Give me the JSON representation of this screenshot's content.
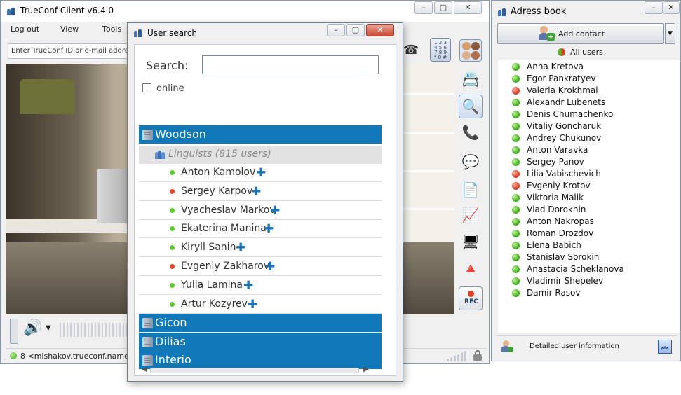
{
  "main_window": {
    "title": "TrueConf Client v6.4.0",
    "menu": [
      "Log out",
      "View",
      "Tools"
    ],
    "id_field_placeholder": "Enter TrueConf ID or e-mail address t",
    "status_text": "8 <mishakov.trueconf.name>",
    "speaker_dropdown": "▼",
    "record_label": "REC",
    "controls": {
      "minimize": "–",
      "maximize": "▢",
      "close": "✕"
    }
  },
  "search_window": {
    "title": "User search",
    "search_label": "Search:",
    "search_value": "",
    "online_label": "online",
    "online_checked": false,
    "controls": {
      "minimize": "–",
      "maximize": "▢",
      "close": "✕"
    },
    "companies": [
      {
        "name": "Woodson",
        "expanded": true
      },
      {
        "name": "Gicon",
        "expanded": false
      },
      {
        "name": "Dilias",
        "expanded": false
      },
      {
        "name": "Interio",
        "expanded": false
      }
    ],
    "department": "Linguists (815 users)",
    "users": [
      {
        "name": "Anton Kamolov",
        "status": "online"
      },
      {
        "name": "Sergey Karpov",
        "status": "busy"
      },
      {
        "name": "Vyacheslav Markov",
        "status": "online"
      },
      {
        "name": "Ekaterina Manina",
        "status": "online"
      },
      {
        "name": "Kiryll Sanin",
        "status": "online"
      },
      {
        "name": "Evgeniy Zakharov",
        "status": "busy"
      },
      {
        "name": "Yulia Lamina",
        "status": "online"
      },
      {
        "name": "Artur Kozyrev",
        "status": "online"
      }
    ],
    "add_symbol": "✚"
  },
  "address_book": {
    "title": "Adress book",
    "add_contact_label": "Add contact",
    "filter_label": "All users",
    "contacts": [
      {
        "name": "Anna Kretova",
        "status": "online"
      },
      {
        "name": "Egor Pankratyev",
        "status": "online"
      },
      {
        "name": "Valeria Krokhmal",
        "status": "busy"
      },
      {
        "name": "Alexandr Lubenets",
        "status": "online"
      },
      {
        "name": "Denis Chumachenko",
        "status": "online"
      },
      {
        "name": "Vitaliy Goncharuk",
        "status": "online"
      },
      {
        "name": "Andrey Chukunov",
        "status": "online"
      },
      {
        "name": "Anton Varavka",
        "status": "online"
      },
      {
        "name": "Sergey Panov",
        "status": "online"
      },
      {
        "name": "Lilia Vabischevich",
        "status": "busy"
      },
      {
        "name": "Evgeniy Krotov",
        "status": "busy"
      },
      {
        "name": "Viktoria Malik",
        "status": "online"
      },
      {
        "name": "Vlad Dorokhin",
        "status": "online"
      },
      {
        "name": "Anton Nakropas",
        "status": "online"
      },
      {
        "name": "Roman Drozdov",
        "status": "online"
      },
      {
        "name": "Elena Babich",
        "status": "online"
      },
      {
        "name": "Stanislav Sorokin",
        "status": "online"
      },
      {
        "name": "Anastacia Scheklanova",
        "status": "online"
      },
      {
        "name": "Vladimir Shepelev",
        "status": "online"
      },
      {
        "name": "Damir Rasov",
        "status": "online"
      }
    ],
    "detailed_info_label": "Detailed user information",
    "controls": {
      "minimize": "–",
      "close": "✕"
    }
  },
  "colors": {
    "company_row": "#0e78b8",
    "online": "#5ccc2e",
    "busy": "#e4452b",
    "add_plus": "#1b73b5"
  }
}
